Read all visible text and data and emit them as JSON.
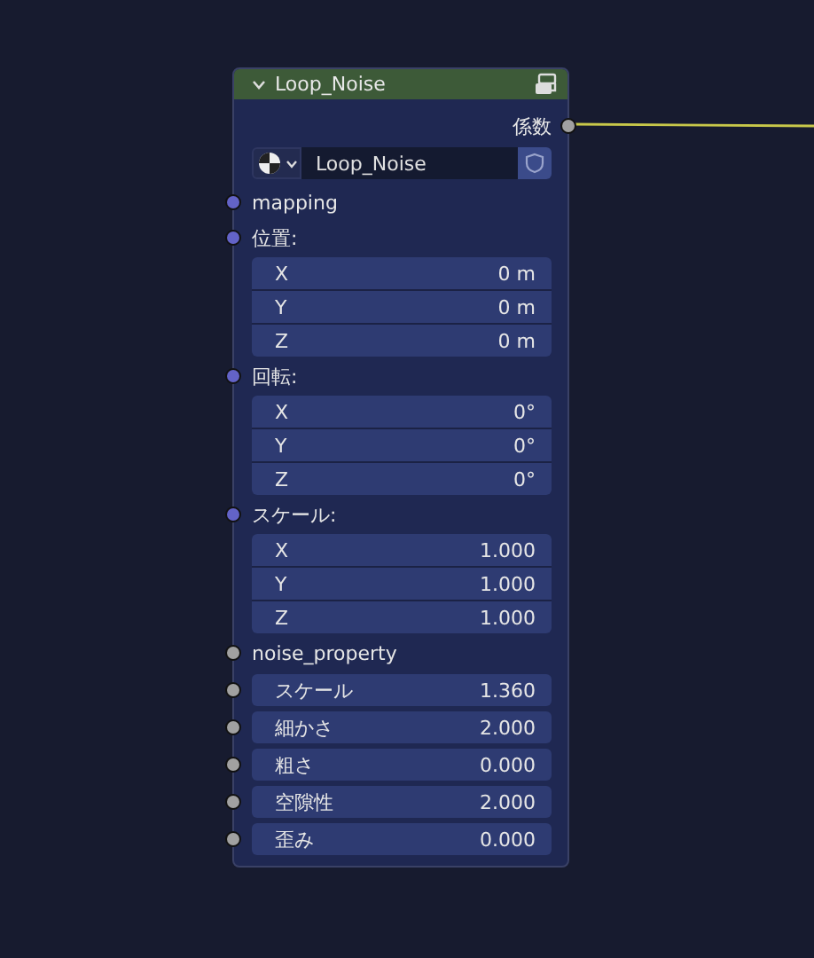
{
  "node": {
    "title": "Loop_Noise",
    "output": {
      "label": "係数",
      "color": "#a1a1a1"
    },
    "datablock": {
      "name": "Loop_Noise"
    },
    "inputs": [
      {
        "kind": "label",
        "label": "mapping",
        "color": "#6363c7"
      },
      {
        "kind": "vector",
        "label": "位置:",
        "color": "#6363c7",
        "rows": [
          {
            "axis": "X",
            "value": "0 m"
          },
          {
            "axis": "Y",
            "value": "0 m"
          },
          {
            "axis": "Z",
            "value": "0 m"
          }
        ]
      },
      {
        "kind": "vector",
        "label": "回転:",
        "color": "#6363c7",
        "rows": [
          {
            "axis": "X",
            "value": "0°"
          },
          {
            "axis": "Y",
            "value": "0°"
          },
          {
            "axis": "Z",
            "value": "0°"
          }
        ]
      },
      {
        "kind": "vector",
        "label": "スケール:",
        "color": "#6363c7",
        "rows": [
          {
            "axis": "X",
            "value": "1.000"
          },
          {
            "axis": "Y",
            "value": "1.000"
          },
          {
            "axis": "Z",
            "value": "1.000"
          }
        ]
      },
      {
        "kind": "label",
        "label": "noise_property",
        "color": "#a1a1a1"
      },
      {
        "kind": "value",
        "label": "スケール",
        "value": "1.360",
        "color": "#a1a1a1"
      },
      {
        "kind": "value",
        "label": "細かさ",
        "value": "2.000",
        "color": "#a1a1a1"
      },
      {
        "kind": "value",
        "label": "粗さ",
        "value": "0.000",
        "color": "#a1a1a1"
      },
      {
        "kind": "value",
        "label": "空隙性",
        "value": "2.000",
        "color": "#a1a1a1"
      },
      {
        "kind": "value",
        "label": "歪み",
        "value": "0.000",
        "color": "#a1a1a1"
      }
    ]
  }
}
